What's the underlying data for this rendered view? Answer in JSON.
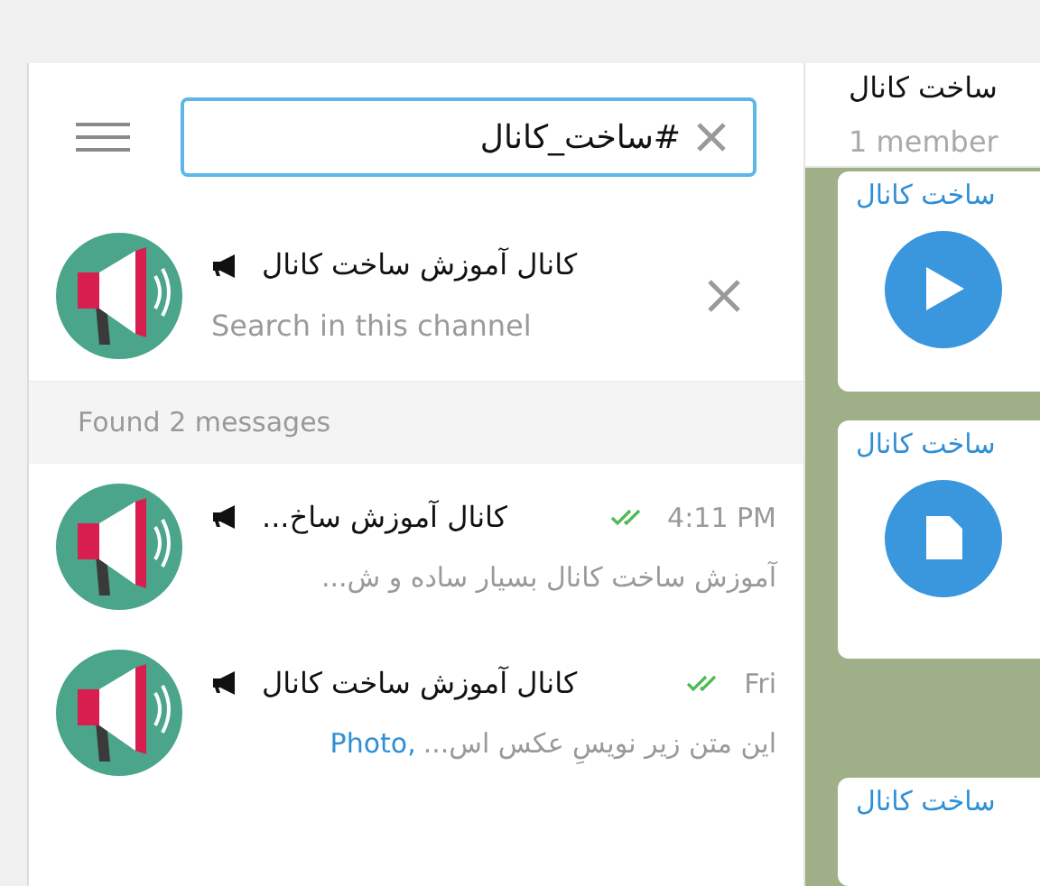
{
  "search": {
    "value": "#ساخت_کانال"
  },
  "channel_filter": {
    "name": "کانال آموزش ساخت کانال",
    "hint": "Search in this channel"
  },
  "results_header": "Found 2 messages",
  "results": [
    {
      "name": "کانال آموزش ساخ...",
      "time": "4:11 PM",
      "read": true,
      "preview": "آموزش ساخت کانال بسیار ساده و ش..."
    },
    {
      "name": "کانال آموزش ساخت کانال",
      "time": "Fri",
      "read": true,
      "preview_type": "Photo,",
      "preview": "این متن زیر نویسِ عکس اس..."
    }
  ],
  "chat": {
    "title": "ساخت کانال",
    "subtitle": "1 member",
    "messages": [
      {
        "kind": "video",
        "sender": "ساخت کانال"
      },
      {
        "kind": "file",
        "sender": "ساخت کانال"
      },
      {
        "kind": "text",
        "sender": "ساخت کانال"
      }
    ]
  }
}
